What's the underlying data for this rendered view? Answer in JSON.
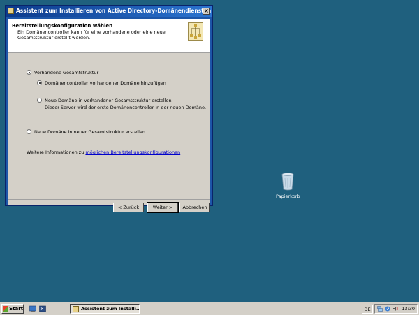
{
  "window": {
    "title": "Assistent zum Installieren von Active Directory-Domänendiensten",
    "close_glyph": "×"
  },
  "header": {
    "title": "Bereitstellungskonfiguration wählen",
    "description": "Ein Domänencontroller kann für eine vorhandene oder eine neue Gesamtstruktur erstellt werden."
  },
  "options": {
    "existing_forest": {
      "label": "Vorhandene Gesamtstruktur",
      "checked": true
    },
    "add_dc": {
      "label": "Domänencontroller vorhandener Domäne hinzufügen",
      "checked": true
    },
    "new_domain": {
      "label": "Neue Domäne in vorhandener Gesamtstruktur erstellen",
      "sublabel": "Dieser Server wird der erste Domänencontroller in der neuen Domäne.",
      "checked": false
    },
    "new_forest": {
      "label": "Neue Domäne in neuer Gesamtstruktur erstellen",
      "checked": false
    }
  },
  "more_info": {
    "prefix": "Weitere Informationen zu",
    "link": "möglichen Bereitstellungskonfigurationen"
  },
  "buttons": {
    "back": "< Zurück",
    "next": "Weiter >",
    "cancel": "Abbrechen"
  },
  "desktop": {
    "recycle_bin": "Papierkorb"
  },
  "taskbar": {
    "start": "Start",
    "task": "Assistent zum Installi...",
    "language": "DE",
    "time": "13:30"
  },
  "colors": {
    "desktop": "#1f607e",
    "title_gradient_start": "#0c3a8c",
    "title_gradient_end": "#2b74d0",
    "link": "#0000cc"
  }
}
